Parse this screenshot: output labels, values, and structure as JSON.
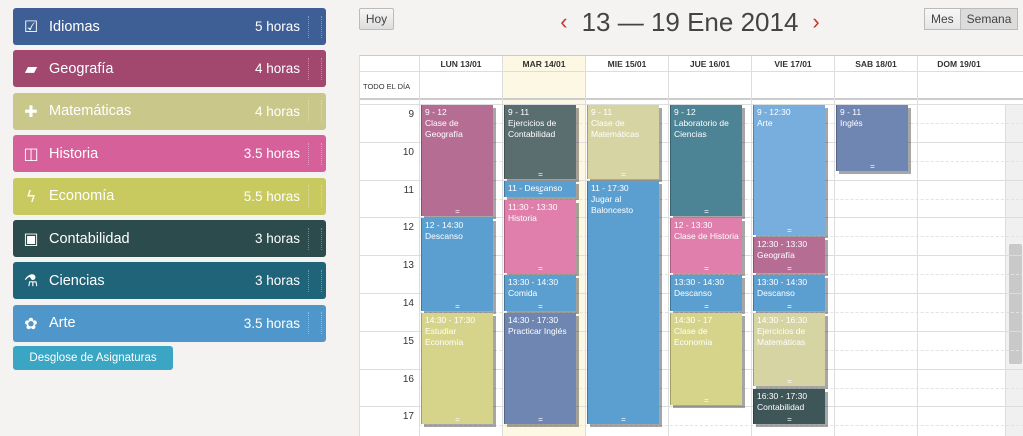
{
  "sidebar": {
    "subjects": [
      {
        "name": "Idiomas",
        "hours": "5 horas",
        "icon": "checkbox-icon",
        "glyph": "☑",
        "color": "#3d5f96"
      },
      {
        "name": "Geografía",
        "hours": "4 horas",
        "icon": "book-icon",
        "glyph": "▰",
        "color": "#a2486f"
      },
      {
        "name": "Matemáticas",
        "hours": "4 horas",
        "icon": "plus-icon",
        "glyph": "✚",
        "color": "#c9c78a"
      },
      {
        "name": "Historia",
        "hours": "3.5 horas",
        "icon": "open-book-icon",
        "glyph": "◫",
        "color": "#d5609a"
      },
      {
        "name": "Economía",
        "hours": "5.5 horas",
        "icon": "lightning-icon",
        "glyph": "ϟ",
        "color": "#c8c95e"
      },
      {
        "name": "Contabilidad",
        "hours": "3 horas",
        "icon": "money-icon",
        "glyph": "▣",
        "color": "#2c4b4d"
      },
      {
        "name": "Ciencias",
        "hours": "3 horas",
        "icon": "flask-icon",
        "glyph": "⚗",
        "color": "#1f6479"
      },
      {
        "name": "Arte",
        "hours": "3.5 horas",
        "icon": "palette-icon",
        "glyph": "✿",
        "color": "#4f96ca"
      }
    ],
    "breakdown_button": "Desglose de Asignaturas"
  },
  "toolbar": {
    "today": "Hoy",
    "title": "13 — 19 Ene 2014",
    "prev": "‹",
    "next": "›",
    "month": "Mes",
    "week": "Semana"
  },
  "calendar": {
    "allday_label": "TODO EL DÍA",
    "days": [
      "LUN 13/01",
      "MAR 14/01",
      "MIE 15/01",
      "JUE 16/01",
      "VIE 17/01",
      "SAB 18/01",
      "DOM 19/01"
    ],
    "today_index": 1,
    "hours": [
      "9",
      "10",
      "11",
      "12",
      "13",
      "14",
      "15",
      "16",
      "17"
    ],
    "events": [
      {
        "day": 0,
        "start": 9,
        "end": 12,
        "time": "9 - 12",
        "title": "Clase de Geografía",
        "color": "#b66d93"
      },
      {
        "day": 0,
        "start": 12,
        "end": 14.5,
        "time": "12 - 14:30",
        "title": "Descanso",
        "color": "#5b9fd1"
      },
      {
        "day": 0,
        "start": 14.5,
        "end": 17.5,
        "time": "14:30 - 17:30",
        "title": "Estudiar Economía",
        "color": "#d6d48a"
      },
      {
        "day": 1,
        "start": 9,
        "end": 11,
        "time": "9 - 11",
        "title": "Ejercicios de Contabilidad",
        "color": "#5a6d6f"
      },
      {
        "day": 1,
        "start": 11,
        "end": 11.5,
        "time": "11 - Descanso",
        "title": "",
        "color": "#5b9fd1"
      },
      {
        "day": 1,
        "start": 11.5,
        "end": 13.5,
        "time": "11:30 - 13:30",
        "title": "Historia",
        "color": "#e07fab"
      },
      {
        "day": 1,
        "start": 13.5,
        "end": 14.5,
        "time": "13:30 - 14:30",
        "title": "Comida",
        "color": "#5b9fd1"
      },
      {
        "day": 1,
        "start": 14.5,
        "end": 17.5,
        "time": "14:30 - 17:30",
        "title": "Practicar Inglés",
        "color": "#6f86b3"
      },
      {
        "day": 2,
        "start": 9,
        "end": 11,
        "time": "9 - 11",
        "title": "Clase de Matemáticas",
        "color": "#d6d4a3"
      },
      {
        "day": 2,
        "start": 11,
        "end": 17.5,
        "time": "11 - 17:30",
        "title": "Jugar al Baloncesto",
        "color": "#5b9fd1"
      },
      {
        "day": 3,
        "start": 9,
        "end": 12,
        "time": "9 - 12",
        "title": "Laboratorio de Ciencias",
        "color": "#4c8496"
      },
      {
        "day": 3,
        "start": 12,
        "end": 13.5,
        "time": "12 - 13:30",
        "title": "Clase de Historia",
        "color": "#e07fab"
      },
      {
        "day": 3,
        "start": 13.5,
        "end": 14.5,
        "time": "13:30 - 14:30",
        "title": "Descanso",
        "color": "#5b9fd1"
      },
      {
        "day": 3,
        "start": 14.5,
        "end": 17,
        "time": "14:30 - 17",
        "title": "Clase de Economía",
        "color": "#d6d48a"
      },
      {
        "day": 4,
        "start": 9,
        "end": 12.5,
        "time": "9 - 12:30",
        "title": "Arte",
        "color": "#77aede"
      },
      {
        "day": 4,
        "start": 12.5,
        "end": 13.5,
        "time": "12:30 - 13:30",
        "title": "Geografía",
        "color": "#b66d93"
      },
      {
        "day": 4,
        "start": 13.5,
        "end": 14.5,
        "time": "13:30 - 14:30",
        "title": "Descanso",
        "color": "#5b9fd1"
      },
      {
        "day": 4,
        "start": 14.5,
        "end": 16.5,
        "time": "14:30 - 16:30",
        "title": "Ejercicios de Matemáticas",
        "color": "#d6d4a3"
      },
      {
        "day": 4,
        "start": 16.5,
        "end": 17.5,
        "time": "16:30 - 17:30",
        "title": "Contabilidad",
        "color": "#3e5658"
      },
      {
        "day": 5,
        "start": 9,
        "end": 10.8,
        "time": "9 - 11",
        "title": "Inglés",
        "color": "#6f86b3"
      }
    ]
  }
}
